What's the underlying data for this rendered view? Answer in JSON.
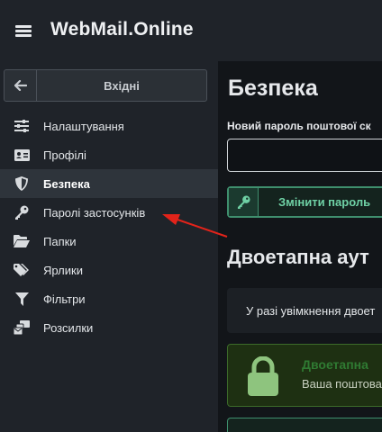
{
  "header": {
    "app_title": "WebMail.Online",
    "menu_icon": "hamburger-icon"
  },
  "sidebar": {
    "back_button": {
      "label": "Вхідні",
      "icon": "arrow-left-icon"
    },
    "items": [
      {
        "label": "Налаштування",
        "icon": "sliders-icon",
        "active": false
      },
      {
        "label": "Профілі",
        "icon": "id-card-icon",
        "active": false
      },
      {
        "label": "Безпека",
        "icon": "shield-icon",
        "active": true
      },
      {
        "label": "Паролі застосунків",
        "icon": "key-icon",
        "active": false
      },
      {
        "label": "Папки",
        "icon": "folder-open-icon",
        "active": false
      },
      {
        "label": "Ярлики",
        "icon": "tags-icon",
        "active": false
      },
      {
        "label": "Фільтри",
        "icon": "filter-icon",
        "active": false
      },
      {
        "label": "Розсилки",
        "icon": "mail-bulk-icon",
        "active": false
      }
    ]
  },
  "main": {
    "title": "Безпека",
    "new_password_label": "Новий пароль поштової ск",
    "new_password_value": "",
    "change_button": {
      "label": "Змінити пароль",
      "icon": "key-icon"
    },
    "twofa_title": "Двоетапна аут",
    "info_text": "У разі увімкнення двоет",
    "status": {
      "heading": "Двоетапна",
      "text": "Ваша поштова",
      "icon": "lock-icon"
    }
  },
  "colors": {
    "accent_green": "#3f8f6e",
    "arrow_red": "#e2231a",
    "active_bg": "#2e343b"
  }
}
